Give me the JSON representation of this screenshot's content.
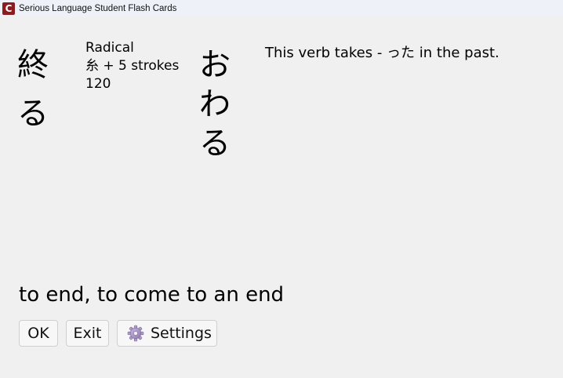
{
  "window": {
    "title": "Serious Language Student Flash Cards",
    "icon_letter": "C",
    "icon_color": "#8b1c20"
  },
  "card": {
    "kanji_chars": [
      "終",
      "る"
    ],
    "radical": {
      "label": "Radical",
      "composition": "糸 + 5 strokes",
      "number": "120"
    },
    "reading_chars": [
      "お",
      "わ",
      "る"
    ],
    "note": "This verb takes - った in the past.",
    "meaning": "to end, to come to an end"
  },
  "buttons": {
    "ok_label": "OK",
    "exit_label": "Exit",
    "settings_label": "Settings",
    "settings_icon": "gear-icon"
  }
}
